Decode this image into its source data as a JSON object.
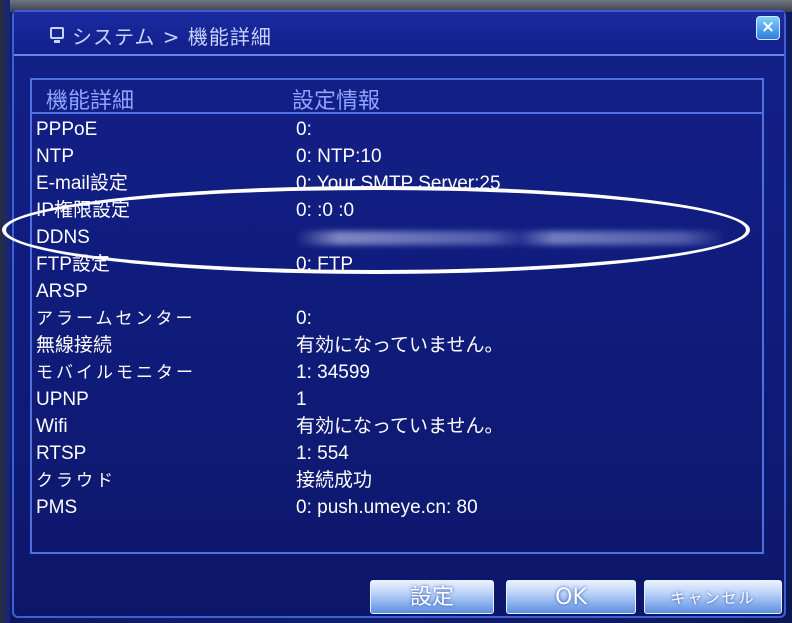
{
  "window": {
    "title": "システム > 機能詳細",
    "close_label": "×"
  },
  "table": {
    "headers": [
      "機能詳細",
      "設定情報"
    ],
    "rows": [
      {
        "name": "PPPoE",
        "value": "0:"
      },
      {
        "name": "NTP",
        "value": "0: NTP:10"
      },
      {
        "name": "E-mail設定",
        "value": "0: Your SMTP Server:25"
      },
      {
        "name": "IP権限設定",
        "value": "0: :0 :0"
      },
      {
        "name": "DDNS",
        "value": ""
      },
      {
        "name": "FTP設定",
        "value": "0: FTP"
      },
      {
        "name": "ARSP",
        "value": ""
      },
      {
        "name": "アラームセンター",
        "value": "0:"
      },
      {
        "name": "無線接続",
        "value": "有効になっていません。"
      },
      {
        "name": "モバイルモニター",
        "value": "1: 34599"
      },
      {
        "name": "UPNP",
        "value": "1"
      },
      {
        "name": "Wifi",
        "value": "有効になっていません。"
      },
      {
        "name": "RTSP",
        "value": "1: 554"
      },
      {
        "name": "クラウド",
        "value": "接続成功"
      },
      {
        "name": "PMS",
        "value": "0: push.umeye.cn: 80"
      }
    ]
  },
  "buttons": {
    "settings": "設定",
    "ok": "OK",
    "cancel": "キャンセル"
  },
  "colors": {
    "background": "#142381",
    "border": "#4f70e0",
    "header_text": "#8ea4ff",
    "annotation": "#ffffff"
  }
}
